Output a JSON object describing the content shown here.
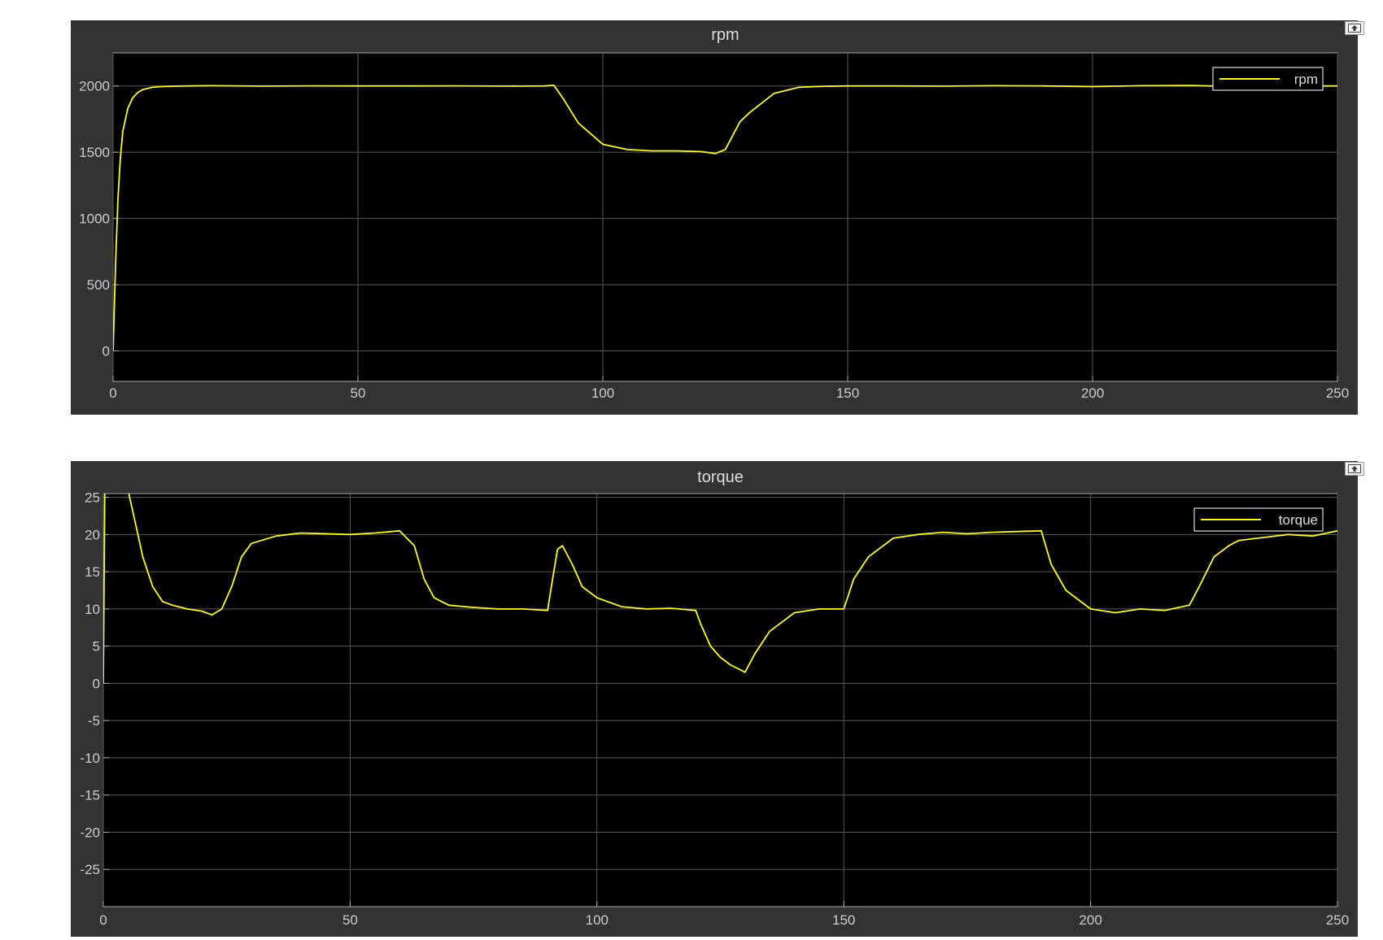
{
  "chart_data": [
    {
      "type": "line",
      "title": "rpm",
      "xlabel": "",
      "ylabel": "",
      "xlim": [
        0,
        250
      ],
      "ylim": [
        -230,
        2250
      ],
      "xticks": [
        0,
        50,
        100,
        150,
        200,
        250
      ],
      "yticks": [
        0,
        500,
        1000,
        1500,
        2000
      ],
      "grid": true,
      "legend_position": "top-right",
      "background": "#000000",
      "line_color": "#ffff00",
      "series": [
        {
          "name": "rpm",
          "x": [
            0,
            0.5,
            1,
            1.5,
            2,
            3,
            4,
            5,
            6,
            8,
            10,
            15,
            20,
            30,
            40,
            50,
            60,
            70,
            80,
            88,
            90,
            92,
            95,
            100,
            105,
            110,
            115,
            120,
            123,
            125,
            128,
            130,
            135,
            140,
            145,
            150,
            160,
            170,
            180,
            190,
            200,
            210,
            220,
            230,
            240,
            250
          ],
          "y": [
            0,
            650,
            1150,
            1460,
            1660,
            1830,
            1910,
            1950,
            1972,
            1990,
            1996,
            2000,
            2002,
            1999,
            2001,
            2000,
            2000,
            2001,
            1999,
            2000,
            2005,
            1900,
            1720,
            1560,
            1520,
            1510,
            1510,
            1505,
            1490,
            1520,
            1730,
            1800,
            1945,
            1990,
            1998,
            2000,
            2000,
            1999,
            2002,
            2000,
            1995,
            2002,
            2003,
            1996,
            2000,
            2000
          ]
        }
      ]
    },
    {
      "type": "line",
      "title": "torque",
      "xlabel": "",
      "ylabel": "",
      "xlim": [
        0,
        250
      ],
      "ylim": [
        -30,
        25.5
      ],
      "xticks": [
        0,
        50,
        100,
        150,
        200,
        250
      ],
      "yticks": [
        -25,
        -20,
        -15,
        -10,
        -5,
        0,
        5,
        10,
        15,
        20,
        25
      ],
      "grid": true,
      "legend_position": "top-right",
      "background": "#000000",
      "line_color": "#ffff00",
      "series": [
        {
          "name": "torque",
          "x": [
            0,
            0.3,
            0.6,
            1,
            3,
            5,
            7,
            8,
            10,
            12,
            14,
            17,
            20,
            22,
            24,
            26,
            28,
            30,
            35,
            40,
            45,
            50,
            55,
            60,
            63,
            65,
            67,
            70,
            75,
            80,
            85,
            90,
            91,
            92,
            93,
            95,
            97,
            100,
            105,
            110,
            115,
            120,
            121,
            123,
            125,
            127,
            130,
            132,
            135,
            138,
            140,
            145,
            150,
            152,
            155,
            160,
            165,
            170,
            175,
            180,
            185,
            190,
            192,
            195,
            200,
            205,
            210,
            215,
            220,
            222,
            225,
            228,
            230,
            235,
            240,
            245,
            250
          ],
          "y": [
            0,
            26,
            27,
            27,
            27,
            26,
            20,
            17,
            13,
            11,
            10.5,
            10,
            9.7,
            9.2,
            10,
            13,
            17,
            18.8,
            19.8,
            20.2,
            20.1,
            20,
            20.2,
            20.5,
            18.5,
            14,
            11.5,
            10.5,
            10.2,
            10,
            10,
            9.8,
            14,
            18,
            18.5,
            16,
            13,
            11.5,
            10.3,
            10,
            10.1,
            9.8,
            8,
            5,
            3.5,
            2.5,
            1.5,
            4,
            7,
            8.5,
            9.5,
            10,
            10,
            14,
            17,
            19.5,
            20,
            20.3,
            20.1,
            20.3,
            20.4,
            20.5,
            16,
            12.5,
            10,
            9.5,
            10,
            9.8,
            10.5,
            13,
            17,
            18.5,
            19.2,
            19.6,
            20,
            19.8,
            20.5
          ]
        }
      ]
    }
  ]
}
